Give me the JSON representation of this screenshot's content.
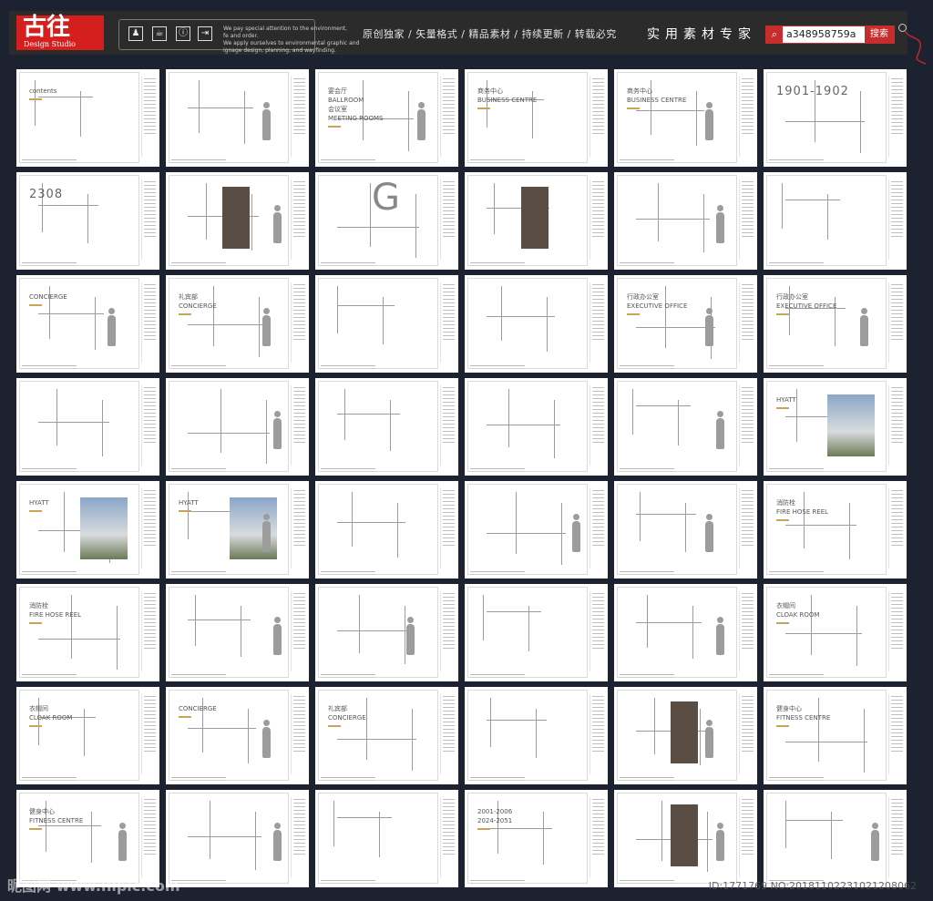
{
  "header": {
    "logo_text": "古往",
    "logo_sub": "Design Studio",
    "motto": [
      "We pay special attention to the environment,",
      "fe and order.",
      "We apply ourselves to environmental graphic and",
      "ignage design, planning, and wayfinding."
    ],
    "features": "原创独家 / 矢量格式 / 精品素材 / 持续更新 / 转载必究",
    "tagline": "实用素材专家",
    "search_value": "a348958759a",
    "search_button": "搜索",
    "icons": [
      "restroom-icon",
      "coffee-icon",
      "info-icon",
      "exit-icon"
    ],
    "accent_color": "#d51f1f"
  },
  "sheets": [
    {
      "labels": [
        "contents"
      ]
    },
    {
      "labels": []
    },
    {
      "labels": [
        "宴会厅",
        "BALLROOM",
        "会议室",
        "MEETING ROOMS"
      ]
    },
    {
      "labels": [
        "商务中心",
        "BUSINESS CENTRE"
      ]
    },
    {
      "labels": [
        "商务中心",
        "BUSINESS CENTRE"
      ]
    },
    {
      "labels": [
        "1901-1902"
      ]
    },
    {
      "labels": [
        "2308"
      ]
    },
    {
      "labels": []
    },
    {
      "labels": [
        "G"
      ]
    },
    {
      "labels": []
    },
    {
      "labels": []
    },
    {
      "labels": []
    },
    {
      "labels": [
        "CONCIERGE"
      ]
    },
    {
      "labels": [
        "礼宾部",
        "CONCIERGE"
      ]
    },
    {
      "labels": []
    },
    {
      "labels": []
    },
    {
      "labels": [
        "行政办公室",
        "EXECUTIVE OFFICE"
      ]
    },
    {
      "labels": [
        "行政办公室",
        "EXECUTIVE OFFICE"
      ]
    },
    {
      "labels": []
    },
    {
      "labels": []
    },
    {
      "labels": []
    },
    {
      "labels": []
    },
    {
      "labels": []
    },
    {
      "labels": [
        "HYATT"
      ]
    },
    {
      "labels": [
        "HYATT"
      ]
    },
    {
      "labels": [
        "HYATT"
      ]
    },
    {
      "labels": []
    },
    {
      "labels": []
    },
    {
      "labels": []
    },
    {
      "labels": [
        "消防栓",
        "FIRE HOSE REEL"
      ]
    },
    {
      "labels": [
        "消防栓",
        "FIRE HOSE REEL"
      ]
    },
    {
      "labels": []
    },
    {
      "labels": []
    },
    {
      "labels": []
    },
    {
      "labels": []
    },
    {
      "labels": [
        "衣帽间",
        "CLOAK ROOM"
      ]
    },
    {
      "labels": [
        "衣帽间",
        "CLOAK ROOM"
      ]
    },
    {
      "labels": [
        "CONCIERGE"
      ]
    },
    {
      "labels": [
        "礼宾部",
        "CONCIERGE"
      ]
    },
    {
      "labels": []
    },
    {
      "labels": []
    },
    {
      "labels": [
        "健身中心",
        "FITNESS CENTRE"
      ]
    },
    {
      "labels": [
        "健身中心",
        "FITNESS CENTRE"
      ]
    },
    {
      "labels": []
    },
    {
      "labels": []
    },
    {
      "labels": [
        "2001-2006",
        "2024-2051"
      ]
    },
    {
      "labels": []
    },
    {
      "labels": []
    }
  ],
  "footer": {
    "watermark": "昵图网 www.nipic.com",
    "id_text": "ID:1771769 NO:20181102231021208062"
  }
}
